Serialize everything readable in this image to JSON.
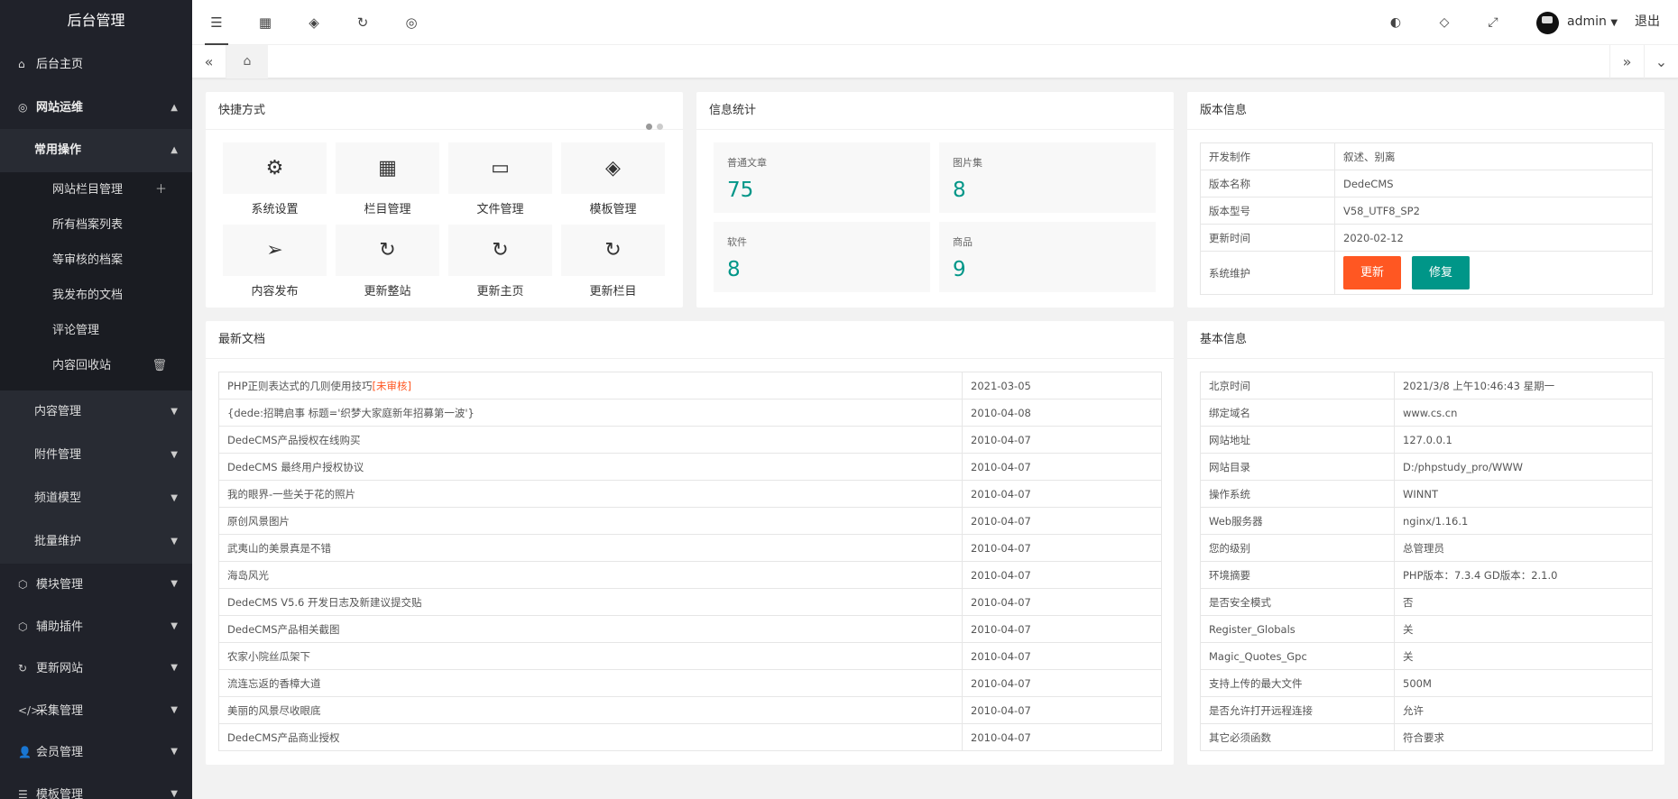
{
  "sidebar": {
    "logo": "后台管理",
    "home": "后台主页",
    "site_ops": "网站运维",
    "common_ops": "常用操作",
    "leaves": [
      "网站栏目管理",
      "所有档案列表",
      "等审核的档案",
      "我发布的文档",
      "评论管理",
      "内容回收站"
    ],
    "subs": [
      "内容管理",
      "附件管理",
      "频道模型",
      "批量维护"
    ],
    "mains": [
      "模块管理",
      "辅助插件",
      "更新网站",
      "采集管理",
      "会员管理",
      "模板管理"
    ]
  },
  "topbar": {
    "username": "admin",
    "logout": "退出"
  },
  "shortcuts": {
    "title": "快捷方式",
    "items": [
      "系统设置",
      "栏目管理",
      "文件管理",
      "模板管理",
      "内容发布",
      "更新整站",
      "更新主页",
      "更新栏目"
    ]
  },
  "stats": {
    "title": "信息统计",
    "items": [
      {
        "label": "普通文章",
        "value": "75"
      },
      {
        "label": "图片集",
        "value": "8"
      },
      {
        "label": "软件",
        "value": "8"
      },
      {
        "label": "商品",
        "value": "9"
      }
    ]
  },
  "version": {
    "title": "版本信息",
    "rows": [
      {
        "k": "开发制作",
        "v": "叙述、别离"
      },
      {
        "k": "版本名称",
        "v": "DedeCMS"
      },
      {
        "k": "版本型号",
        "v": "V58_UTF8_SP2"
      },
      {
        "k": "更新时间",
        "v": "2020-02-12"
      }
    ],
    "maint_label": "系统维护",
    "update_btn": "更新",
    "repair_btn": "修复"
  },
  "docs": {
    "title": "最新文档",
    "pending_tag": "[未审核]",
    "rows": [
      {
        "t": "PHP正则表达式的几则使用技巧",
        "d": "2021-03-05"
      },
      {
        "t": "{dede:招聘启事 标题='织梦大家庭新年招募第一波'}",
        "d": "2010-04-08"
      },
      {
        "t": "DedeCMS产品授权在线购买",
        "d": "2010-04-07"
      },
      {
        "t": "DedeCMS 最终用户授权协议",
        "d": "2010-04-07"
      },
      {
        "t": "我的眼界-一些关于花的照片",
        "d": "2010-04-07"
      },
      {
        "t": "原创风景图片",
        "d": "2010-04-07"
      },
      {
        "t": "武夷山的美景真是不错",
        "d": "2010-04-07"
      },
      {
        "t": "海岛风光",
        "d": "2010-04-07"
      },
      {
        "t": "DedeCMS V5.6 开发日志及新建议提交贴",
        "d": "2010-04-07"
      },
      {
        "t": "DedeCMS产品相关截图",
        "d": "2010-04-07"
      },
      {
        "t": "农家小院丝瓜架下",
        "d": "2010-04-07"
      },
      {
        "t": "流连忘返的香樟大道",
        "d": "2010-04-07"
      },
      {
        "t": "美丽的风景尽收眼底",
        "d": "2010-04-07"
      },
      {
        "t": "DedeCMS产品商业授权",
        "d": "2010-04-07"
      }
    ]
  },
  "basic": {
    "title": "基本信息",
    "rows": [
      {
        "k": "北京时间",
        "v": "2021/3/8 上午10:46:43 星期一"
      },
      {
        "k": "绑定域名",
        "v": "www.cs.cn"
      },
      {
        "k": "网站地址",
        "v": "127.0.0.1"
      },
      {
        "k": "网站目录",
        "v": "D:/phpstudy_pro/WWW"
      },
      {
        "k": "操作系统",
        "v": "WINNT"
      },
      {
        "k": "Web服务器",
        "v": "nginx/1.16.1"
      },
      {
        "k": "您的级别",
        "v": "总管理员"
      },
      {
        "k": "环境摘要",
        "v": "PHP版本：7.3.4 GD版本：2.1.0"
      },
      {
        "k": "是否安全模式",
        "v": "否"
      },
      {
        "k": "Register_Globals",
        "v": "关"
      },
      {
        "k": "Magic_Quotes_Gpc",
        "v": "关"
      },
      {
        "k": "支持上传的最大文件",
        "v": "500M"
      },
      {
        "k": "是否允许打开远程连接",
        "v": "允许"
      },
      {
        "k": "其它必须函数",
        "v": "符合要求"
      }
    ]
  },
  "colors": {
    "accent": "#009688",
    "warn": "#ff5722",
    "sidebar": "#20222a"
  }
}
